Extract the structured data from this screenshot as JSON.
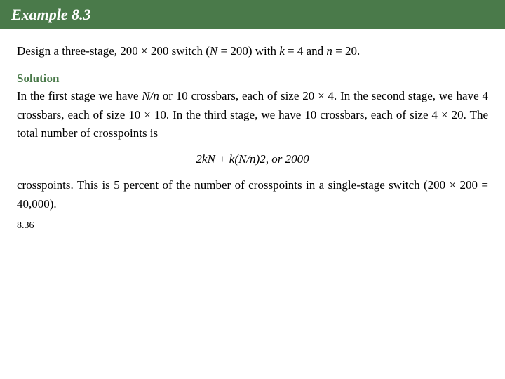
{
  "header": {
    "title": "Example 8.3",
    "bg_color": "#4a7a4a"
  },
  "problem": {
    "text": "Design a three-stage, 200 × 200 switch (N = 200) with k = 4 and n = 20."
  },
  "solution": {
    "label": "Solution",
    "paragraph": "In the first stage we have N/n or 10 crossbars, each of size 20 × 4. In the second stage, we have 4 crossbars, each of size 10 × 10. In the third stage, we have 10 crossbars, each of size 4 × 20. The total number of crosspoints is"
  },
  "formula": {
    "text": "2kN + k(N/n)2, or 2000"
  },
  "footer": {
    "text": "crosspoints. This is 5 percent of the number of crosspoints in a single-stage switch (200 × 200 = 40,000)."
  },
  "page_number": "8.36"
}
